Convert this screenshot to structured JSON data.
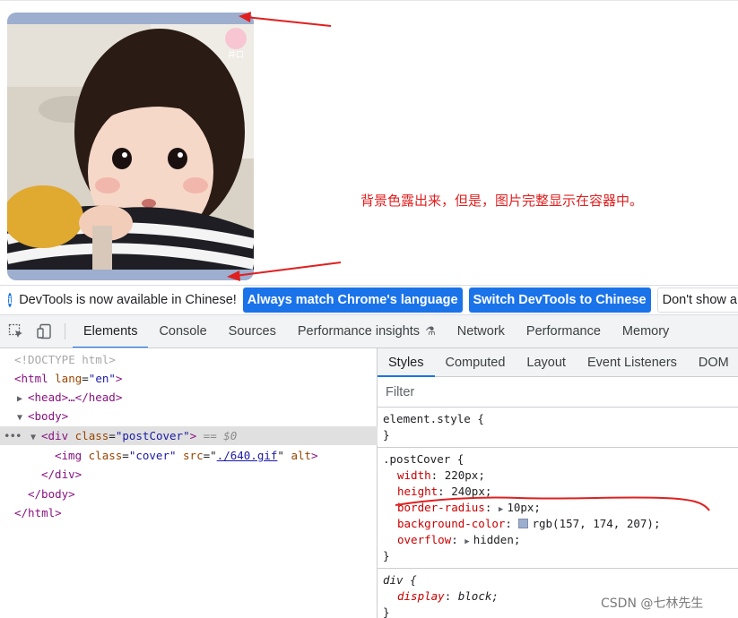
{
  "annotation": {
    "text": "背景色露出来，但是，图片完整显示在容器中。"
  },
  "cover_image": {
    "badge_text": "井口"
  },
  "infobar": {
    "message": "DevTools is now available in Chinese!",
    "buttons": [
      "Always match Chrome's language",
      "Switch DevTools to Chinese",
      "Don't show a"
    ]
  },
  "main_tabs": [
    "Elements",
    "Console",
    "Sources",
    "Performance insights",
    "Network",
    "Performance",
    "Memory"
  ],
  "dom_tree": {
    "doctype": "<!DOCTYPE html>",
    "html_open_prefix": "<html ",
    "html_lang_attr": "lang",
    "html_lang_value": "\"en\"",
    "html_open_suffix": ">",
    "head": "<head>…</head>",
    "body_open": "<body>",
    "div_prefix": "<div ",
    "div_class_attr": "class",
    "div_class_value": "\"postCover\"",
    "div_suffix": ">",
    "selected_marker": "== $0",
    "img_prefix": "<img ",
    "img_class_attr": "class",
    "img_class_value": "\"cover\"",
    "img_src_attr": "src",
    "img_src_link": "./640.gif",
    "img_alt_attr": "alt",
    "img_suffix": ">",
    "div_close": "</div>",
    "body_close": "</body>",
    "html_close": "</html>"
  },
  "styles_tabs": [
    "Styles",
    "Computed",
    "Layout",
    "Event Listeners",
    "DOM"
  ],
  "styles": {
    "filter_placeholder": "Filter",
    "element_style": "element.style {",
    "close_brace": "}",
    "rule_selector": ".postCover {",
    "declarations": [
      {
        "name": "width",
        "value": "220px;"
      },
      {
        "name": "height",
        "value": "240px;"
      },
      {
        "name": "border-radius",
        "value": "10px;"
      },
      {
        "name": "background-color",
        "value": "rgb(157, 174, 207);"
      },
      {
        "name": "overflow",
        "value": "hidden;"
      }
    ],
    "div_selector": "div {",
    "div_decl_name": "display",
    "div_decl_value": "block;"
  },
  "watermark": "CSDN @七林先生",
  "colors": {
    "cover_background": "#9daecf",
    "annotation_red": "#e02020",
    "devtools_blue": "#1a73e8"
  }
}
